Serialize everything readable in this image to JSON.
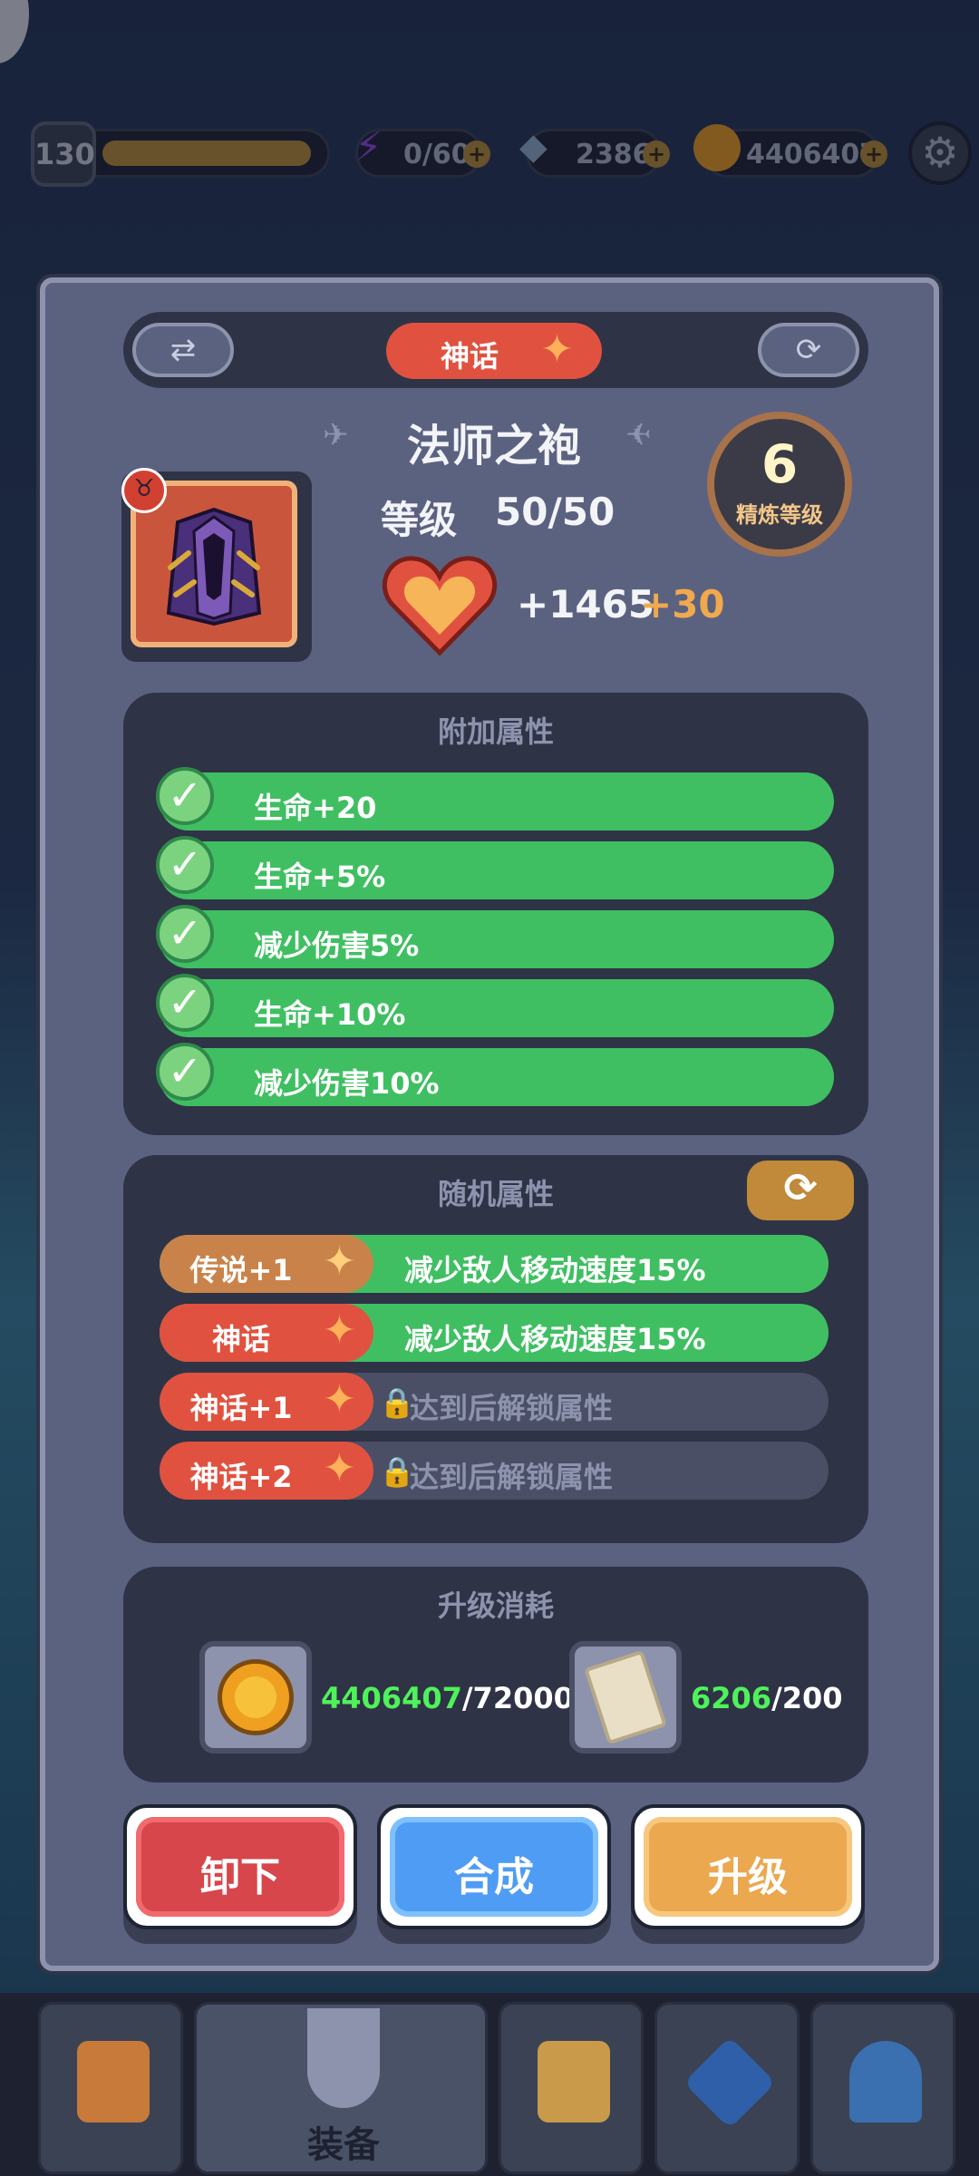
{
  "topbar": {
    "player_level": "130",
    "energy": "0/60",
    "gems": "2386",
    "gold": "4406407"
  },
  "modal": {
    "rarity_tag": "神话",
    "item_name": "法师之袍",
    "level_label": "等级",
    "level_value": "50/50",
    "hp_value": "+1465",
    "hp_bonus": "+30",
    "refine_level": "6",
    "refine_label": "精炼等级"
  },
  "bonus_attrs": {
    "title": "附加属性",
    "items": [
      "生命+20",
      "生命+5%",
      "减少伤害5%",
      "生命+10%",
      "减少伤害10%"
    ]
  },
  "random_attrs": {
    "title": "随机属性",
    "rows": [
      {
        "tag": "传说+1",
        "text": "减少敌人移动速度15%",
        "tag_color": "#c9834a",
        "unlocked": true
      },
      {
        "tag": "神话",
        "text": "减少敌人移动速度15%",
        "tag_color": "#e0523f",
        "unlocked": true
      },
      {
        "tag": "神话+1",
        "text": "达到后解锁属性",
        "tag_color": "#e0523f",
        "unlocked": false
      },
      {
        "tag": "神话+2",
        "text": "达到后解锁属性",
        "tag_color": "#e0523f",
        "unlocked": false
      }
    ]
  },
  "upgrade_cost": {
    "title": "升级消耗",
    "gold_have": "4406407",
    "gold_need": "/72000",
    "scroll_have": "6206",
    "scroll_need": "/200"
  },
  "actions": {
    "unequip": "卸下",
    "merge": "合成",
    "upgrade": "升级"
  },
  "bottom_nav": {
    "active_label": "装备"
  },
  "colors": {
    "green": "#3fbf62",
    "myth_red": "#e0523f",
    "legend_orange": "#c9834a",
    "gold_text": "#f0a94c"
  }
}
